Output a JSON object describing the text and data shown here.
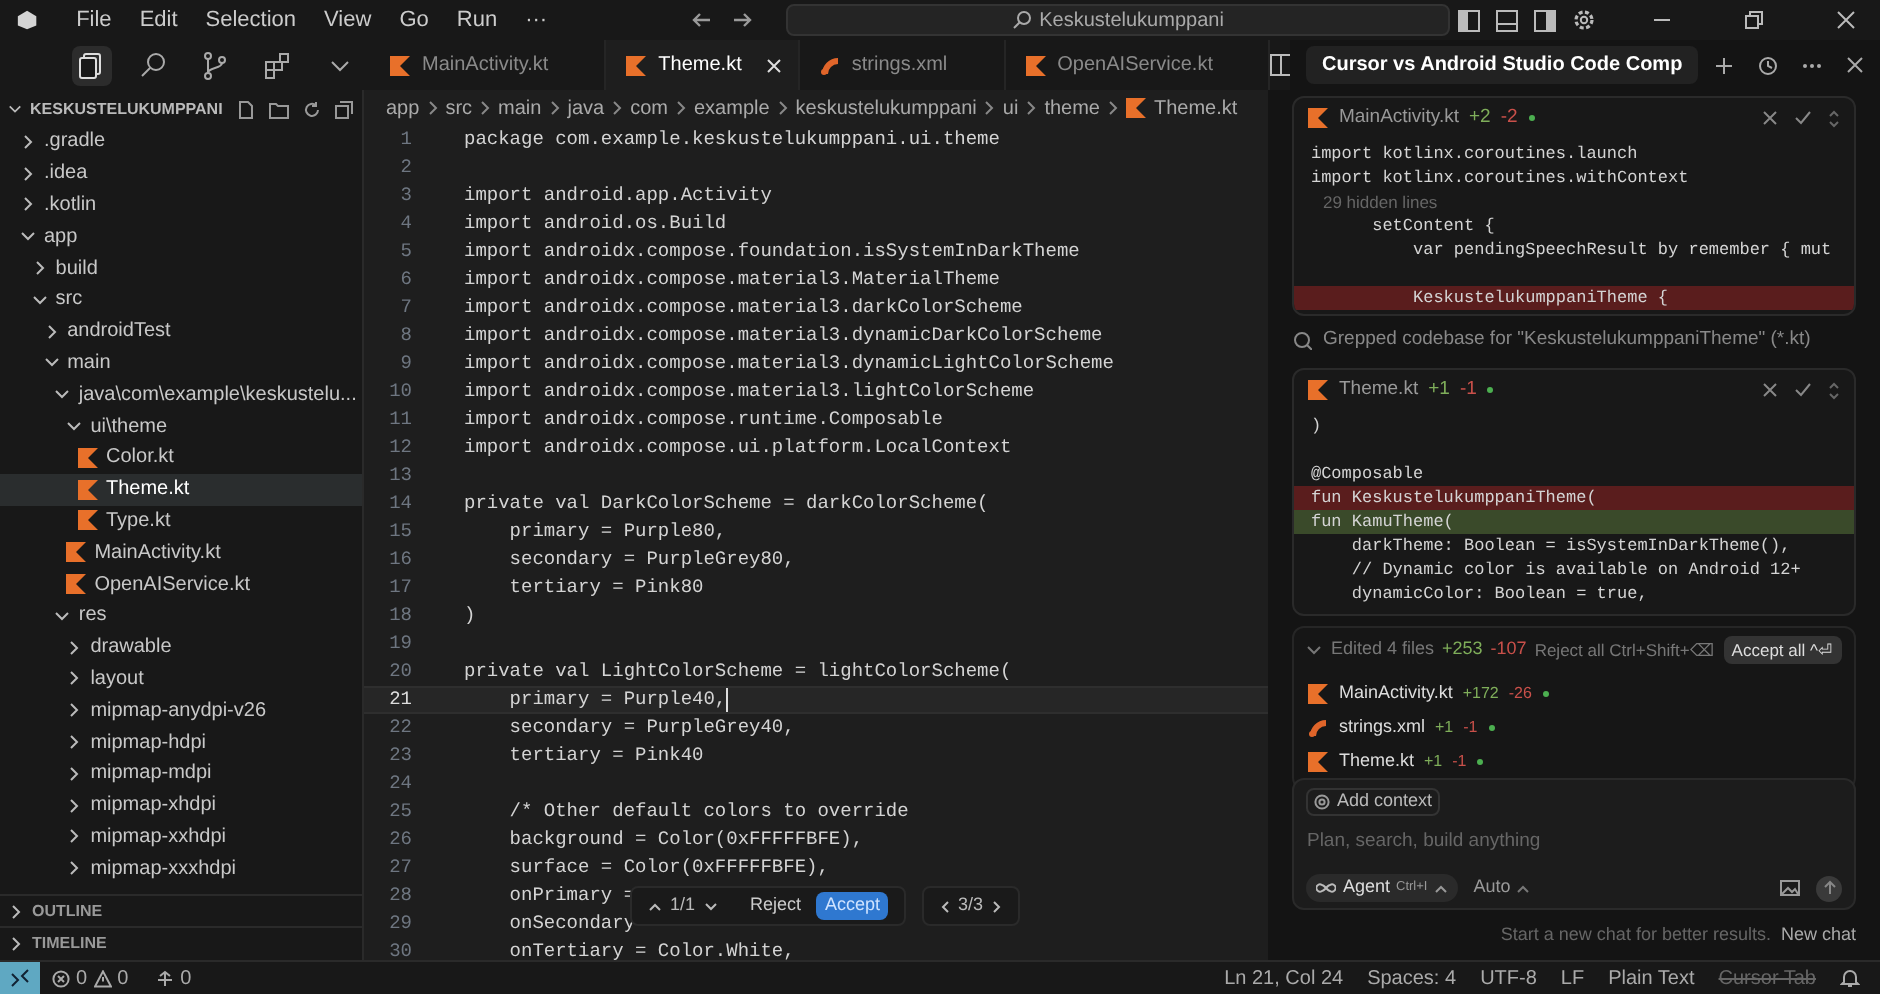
{
  "menu": [
    "File",
    "Edit",
    "Selection",
    "View",
    "Go",
    "Run",
    "···"
  ],
  "search_box": {
    "value": "Keskustelukumppani"
  },
  "activity_icons": [
    {
      "kind": "explorer",
      "selected": true
    },
    {
      "kind": "search",
      "selected": false
    },
    {
      "kind": "branch",
      "selected": false
    },
    {
      "kind": "extensions",
      "selected": false
    },
    {
      "kind": "chevron",
      "selected": false
    }
  ],
  "tabs": [
    {
      "label": "MainActivity.kt",
      "kind": "kotlin",
      "selected": false
    },
    {
      "label": "Theme.kt",
      "kind": "kotlin",
      "selected": true
    },
    {
      "label": "strings.xml",
      "kind": "xml",
      "selected": false
    },
    {
      "label": "OpenAIService.kt",
      "kind": "kotlin",
      "selected": false
    }
  ],
  "explorer": {
    "title": "KESKUSTELUKUMPPANI",
    "tree": [
      {
        "label": ".gradle",
        "kind": "folder",
        "expanded": false,
        "selected": false
      },
      {
        "label": ".idea",
        "kind": "folder",
        "expanded": false,
        "selected": false
      },
      {
        "label": ".kotlin",
        "kind": "folder",
        "expanded": false,
        "selected": false
      },
      {
        "label": "app",
        "kind": "folder",
        "expanded": true,
        "selected": false,
        "children": [
          {
            "label": "build",
            "kind": "folder",
            "expanded": false,
            "selected": false
          },
          {
            "label": "src",
            "kind": "folder",
            "expanded": true,
            "selected": false,
            "children": [
              {
                "label": "androidTest",
                "kind": "folder",
                "expanded": false,
                "selected": false
              },
              {
                "label": "main",
                "kind": "folder",
                "expanded": true,
                "selected": false,
                "children": [
                  {
                    "label": "java\\com\\example\\keskustelu...",
                    "kind": "folder",
                    "expanded": true,
                    "selected": false,
                    "children": [
                      {
                        "label": "ui\\theme",
                        "kind": "folder",
                        "expanded": true,
                        "selected": false,
                        "children": [
                          {
                            "label": "Color.kt",
                            "kind": "kotlin",
                            "selected": false
                          },
                          {
                            "label": "Theme.kt",
                            "kind": "kotlin",
                            "selected": true
                          },
                          {
                            "label": "Type.kt",
                            "kind": "kotlin",
                            "selected": false
                          }
                        ]
                      },
                      {
                        "label": "MainActivity.kt",
                        "kind": "kotlin",
                        "selected": false
                      },
                      {
                        "label": "OpenAIService.kt",
                        "kind": "kotlin",
                        "selected": false
                      }
                    ]
                  },
                  {
                    "label": "res",
                    "kind": "folder",
                    "expanded": true,
                    "selected": false,
                    "children": [
                      {
                        "label": "drawable",
                        "kind": "folder",
                        "expanded": false,
                        "selected": false
                      },
                      {
                        "label": "layout",
                        "kind": "folder",
                        "expanded": false,
                        "selected": false
                      },
                      {
                        "label": "mipmap-anydpi-v26",
                        "kind": "folder",
                        "expanded": false,
                        "selected": false
                      },
                      {
                        "label": "mipmap-hdpi",
                        "kind": "folder",
                        "expanded": false,
                        "selected": false
                      },
                      {
                        "label": "mipmap-mdpi",
                        "kind": "folder",
                        "expanded": false,
                        "selected": false
                      },
                      {
                        "label": "mipmap-xhdpi",
                        "kind": "folder",
                        "expanded": false,
                        "selected": false
                      },
                      {
                        "label": "mipmap-xxhdpi",
                        "kind": "folder",
                        "expanded": false,
                        "selected": false
                      },
                      {
                        "label": "mipmap-xxxhdpi",
                        "kind": "folder",
                        "expanded": false,
                        "selected": false
                      }
                    ]
                  }
                ]
              }
            ]
          }
        ]
      }
    ],
    "sections": [
      "OUTLINE",
      "TIMELINE"
    ]
  },
  "breadcrumb": [
    "app",
    "src",
    "main",
    "java",
    "com",
    "example",
    "keskustelukumppani",
    "ui",
    "theme",
    "Theme.kt"
  ],
  "code": [
    {
      "number": "1",
      "text": "package com.example.keskustelukumppani.ui.theme",
      "current": false
    },
    {
      "number": "2",
      "current": false
    },
    {
      "number": "3",
      "text": "import android.app.Activity",
      "current": false
    },
    {
      "number": "4",
      "text": "import android.os.Build",
      "current": false
    },
    {
      "number": "5",
      "text": "import androidx.compose.foundation.isSystemInDarkTheme",
      "current": false
    },
    {
      "number": "6",
      "text": "import androidx.compose.material3.MaterialTheme",
      "current": false
    },
    {
      "number": "7",
      "text": "import androidx.compose.material3.darkColorScheme",
      "current": false
    },
    {
      "number": "8",
      "text": "import androidx.compose.material3.dynamicDarkColorScheme",
      "current": false
    },
    {
      "number": "9",
      "text": "import androidx.compose.material3.dynamicLightColorScheme",
      "current": false
    },
    {
      "number": "10",
      "text": "import androidx.compose.material3.lightColorScheme",
      "current": false
    },
    {
      "number": "11",
      "text": "import androidx.compose.runtime.Composable",
      "current": false
    },
    {
      "number": "12",
      "text": "import androidx.compose.ui.platform.LocalContext",
      "current": false
    },
    {
      "number": "13",
      "current": false
    },
    {
      "number": "14",
      "text": "private val DarkColorScheme = darkColorScheme(",
      "current": false
    },
    {
      "number": "15",
      "text": "    primary = Purple80,",
      "current": false
    },
    {
      "number": "16",
      "text": "    secondary = PurpleGrey80,",
      "current": false
    },
    {
      "number": "17",
      "text": "    tertiary = Pink80",
      "current": false
    },
    {
      "number": "18",
      "text": ")",
      "current": false
    },
    {
      "number": "19",
      "current": false
    },
    {
      "number": "20",
      "text": "private val LightColorScheme = lightColorScheme(",
      "current": false
    },
    {
      "number": "21",
      "text": "    primary = Purple40,",
      "current": true
    },
    {
      "number": "22",
      "text": "    secondary = PurpleGrey40,",
      "current": false
    },
    {
      "number": "23",
      "text": "    tertiary = Pink40",
      "current": false
    },
    {
      "number": "24",
      "current": false
    },
    {
      "number": "25",
      "text": "    /* Other default colors to override",
      "current": false
    },
    {
      "number": "26",
      "text": "    background = Color(0xFFFFFBFE),",
      "current": false
    },
    {
      "number": "27",
      "text": "    surface = Color(0xFFFFFBFE),",
      "current": false
    },
    {
      "number": "28",
      "text": "    onPrimary =",
      "current": false
    },
    {
      "number": "29",
      "text": "    onSecondary",
      "current": false
    },
    {
      "number": "30",
      "text": "    onTertiary = Color.White,",
      "current": false
    }
  ],
  "diff_toolbar": {
    "counter": "1/1",
    "reject": "Reject",
    "accept": "Accept",
    "pager": "3/3"
  },
  "chat": {
    "title": "Cursor vs Android Studio Code Comp",
    "cards": [
      {
        "file": "MainActivity.kt",
        "added": "+2",
        "removed": "-2",
        "lines": [
          {
            "kind": "context",
            "text": "import kotlinx.coroutines.launch"
          },
          {
            "kind": "context",
            "text": "import kotlinx.coroutines.withContext"
          },
          {
            "kind": "hidden",
            "text": "29 hidden lines"
          },
          {
            "kind": "context",
            "text": "      setContent {"
          },
          {
            "kind": "context",
            "text": "          var pendingSpeechResult by remember { mut"
          },
          {
            "kind": "context"
          },
          {
            "kind": "removed",
            "text": "          KeskustelukumppaniTheme {"
          }
        ]
      },
      {
        "file": "Theme.kt",
        "added": "+1",
        "removed": "-1",
        "lines": [
          {
            "kind": "context",
            "text": ")"
          },
          {
            "kind": "context"
          },
          {
            "kind": "context",
            "text": "@Composable"
          },
          {
            "kind": "removed",
            "text": "fun KeskustelukumppaniTheme("
          },
          {
            "kind": "added",
            "text": "fun KamuTheme("
          },
          {
            "kind": "context",
            "text": "    darkTheme: Boolean = isSystemInDarkTheme(),"
          },
          {
            "kind": "context",
            "text": "    // Dynamic color is available on Android 12+"
          },
          {
            "kind": "context",
            "text": "    dynamicColor: Boolean = true,"
          }
        ]
      }
    ],
    "grep": "Grepped codebase for \"KeskustelukumppaniTheme\" (*.kt)",
    "edited": {
      "label": "Edited 4 files",
      "added": "+253",
      "removed": "-107",
      "reject_all": "Reject all Ctrl+Shift+⌫",
      "accept_all": "Accept all ^⏎",
      "files": [
        {
          "name": "MainActivity.kt",
          "kind": "kotlin",
          "added": "+172",
          "removed": "-26"
        },
        {
          "name": "strings.xml",
          "kind": "xml",
          "added": "+1",
          "removed": "-1"
        },
        {
          "name": "Theme.kt",
          "kind": "kotlin",
          "added": "+1",
          "removed": "-1"
        }
      ]
    },
    "add_context": "Add context",
    "placeholder": "Plan, search, build anything",
    "mode": "Agent",
    "mode_shortcut": "Ctrl+I",
    "model": "Auto",
    "hint": "Start a new chat for better results.",
    "new_chat": "New chat"
  },
  "status": {
    "errors": "0",
    "warnings": "0",
    "ports": "0",
    "right": [
      {
        "text": "Ln 21, Col 24",
        "disabled": false
      },
      {
        "text": "Spaces: 4",
        "disabled": false
      },
      {
        "text": "UTF-8",
        "disabled": false
      },
      {
        "text": "LF",
        "disabled": false
      },
      {
        "text": "Plain Text",
        "disabled": false
      },
      {
        "text": "Cursor Tab",
        "disabled": true
      }
    ]
  }
}
